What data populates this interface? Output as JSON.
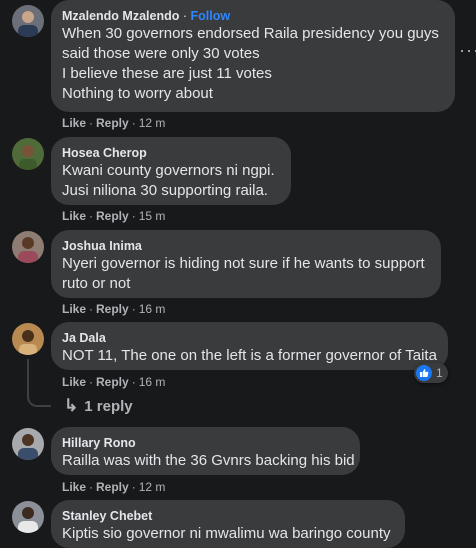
{
  "actions": {
    "like": "Like",
    "reply": "Reply",
    "dot": "·"
  },
  "comments": [
    {
      "name": "Mzalendo Mzalendo",
      "follow": "Follow",
      "lines": [
        "When 30 governors endorsed Raila presidency you guys",
        "said those were only 30 votes",
        "I believe these are just 11 votes",
        "Nothing to worry about"
      ],
      "time": "12 m"
    },
    {
      "name": "Hosea Cherop",
      "lines": [
        "Kwani county governors ni ngpi.",
        "Jusi niliona 30 supporting raila."
      ],
      "time": "15 m"
    },
    {
      "name": "Joshua Inima",
      "lines": [
        "Nyeri governor is hiding not sure if he wants to support",
        "ruto or not"
      ],
      "time": "16 m"
    },
    {
      "name": "Ja Dala",
      "lines": [
        "NOT 11, The one on the left is a former governor of Taita"
      ],
      "time": "16 m",
      "likes": "1"
    },
    {
      "name": "Hillary Rono",
      "lines": [
        "Railla was with the 36 Gvnrs backing his bid"
      ],
      "time": "12 m"
    },
    {
      "name": "Stanley Chebet",
      "lines": [
        "Kiptis sio governor ni mwalimu wa baringo county"
      ]
    }
  ],
  "replies_link": "1 reply",
  "colors": {
    "background": "#18191a",
    "bubble": "#3a3b3c",
    "follow": "#2d88ff",
    "like_blue": "#1877f2",
    "muted": "#b0b3b8"
  }
}
